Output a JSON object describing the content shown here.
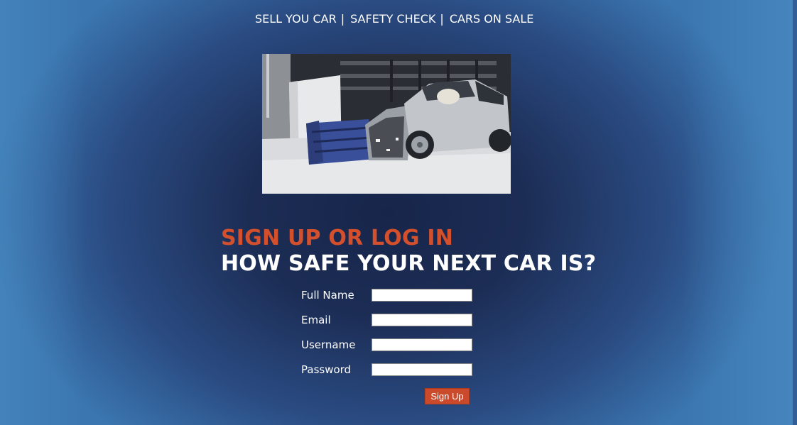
{
  "nav": {
    "items": [
      {
        "label": "SELL YOU CAR"
      },
      {
        "label": "SAFETY CHECK"
      },
      {
        "label": "CARS ON SALE"
      }
    ],
    "separator": "|"
  },
  "hero": {
    "alt": "Crash test photo"
  },
  "heading": {
    "line1": "SIGN UP OR LOG IN",
    "line2": "HOW SAFE YOUR NEXT CAR IS?"
  },
  "form": {
    "fields": [
      {
        "label": "Full Name",
        "value": "",
        "placeholder": ""
      },
      {
        "label": "Email",
        "value": "",
        "placeholder": ""
      },
      {
        "label": "Username",
        "value": "",
        "placeholder": ""
      },
      {
        "label": "Password",
        "value": "",
        "placeholder": ""
      }
    ],
    "submit_label": "Sign Up"
  },
  "colors": {
    "accent": "#d4502c",
    "button": "#cc4a2c",
    "background_center": "#17254a",
    "background_edge": "#3b76b0"
  }
}
